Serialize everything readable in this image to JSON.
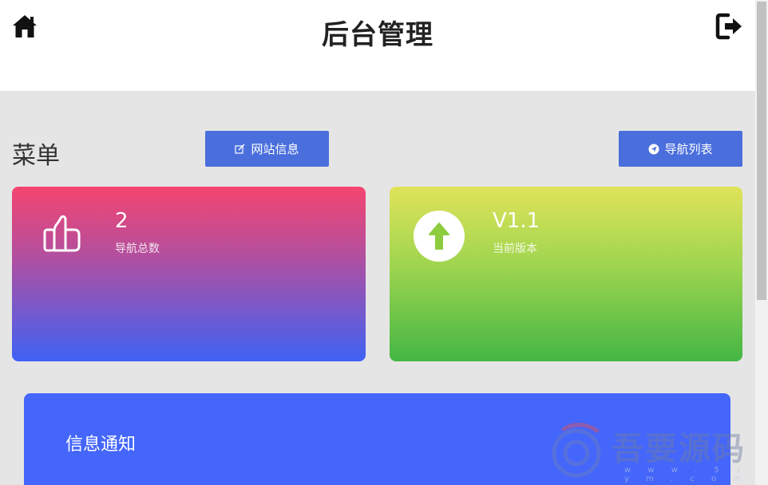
{
  "header": {
    "title": "后台管理",
    "home_icon": "home-icon",
    "logout_icon": "logout-icon"
  },
  "menu": {
    "title": "菜单",
    "site_info_button": "网站信息",
    "nav_list_button": "导航列表"
  },
  "stats": {
    "nav_total": {
      "value": "2",
      "label": "导航总数",
      "icon": "thumbs-up-icon"
    },
    "version": {
      "value": "V1.1",
      "label": "当前版本",
      "icon": "arrow-up-circle-icon"
    }
  },
  "notice": {
    "title": "信息通知"
  },
  "watermark": {
    "text": "吾要源码",
    "sub": "w w w . 5 y y m . c o m"
  },
  "colors": {
    "button_blue": "#4a6fdc",
    "notice_blue": "#4466fb",
    "card_pink": "#f5456f",
    "card_green": "#44b644"
  }
}
